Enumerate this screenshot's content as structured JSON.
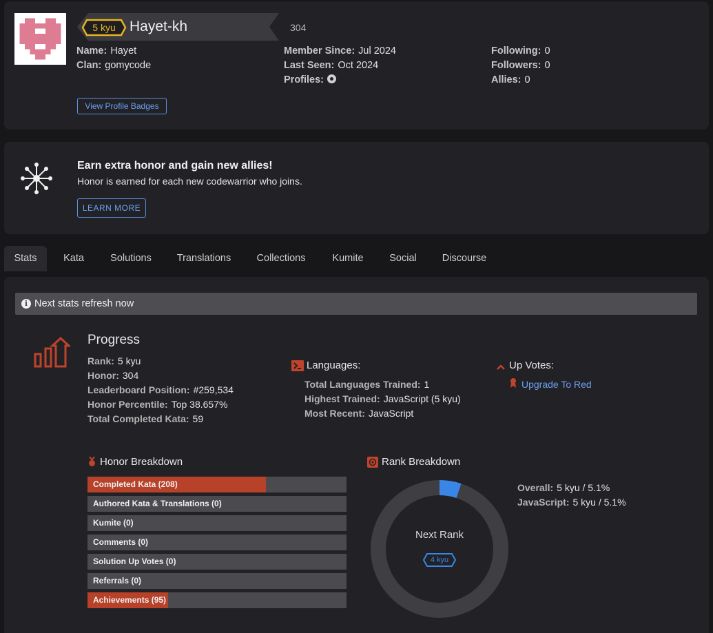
{
  "profile": {
    "rank_badge": "5 kyu",
    "username": "Hayet-kh",
    "honor": "304",
    "name_label": "Name:",
    "name_value": "Hayet",
    "clan_label": "Clan:",
    "clan_value": "gomycode",
    "member_label": "Member Since:",
    "member_value": "Jul 2024",
    "seen_label": "Last Seen:",
    "seen_value": "Oct 2024",
    "profiles_label": "Profiles:",
    "following_label": "Following:",
    "following_value": "0",
    "followers_label": "Followers:",
    "followers_value": "0",
    "allies_label": "Allies:",
    "allies_value": "0",
    "badges_button": "View Profile Badges"
  },
  "promo": {
    "title": "Earn extra honor and gain new allies!",
    "subtitle": "Honor is earned for each new codewarrior who joins.",
    "button": "LEARN MORE"
  },
  "tabs": [
    "Stats",
    "Kata",
    "Solutions",
    "Translations",
    "Collections",
    "Kumite",
    "Social",
    "Discourse"
  ],
  "stats": {
    "notice": "Next stats refresh now",
    "progress_title": "Progress",
    "rank_label": "Rank:",
    "rank_value": "5 kyu",
    "honor_label": "Honor:",
    "honor_value": "304",
    "leader_label": "Leaderboard Position:",
    "leader_value": "#259,534",
    "percentile_label": "Honor Percentile:",
    "percentile_value": "Top 38.657%",
    "completed_label": "Total Completed Kata:",
    "completed_value": "59",
    "languages_title": "Languages:",
    "lang_trained_label": "Total Languages Trained:",
    "lang_trained_value": "1",
    "highest_label": "Highest Trained:",
    "highest_value": "JavaScript (5 kyu)",
    "recent_label": "Most Recent:",
    "recent_value": "JavaScript",
    "upvotes_title": "Up Votes:",
    "upgrade_link": "Upgrade To Red",
    "honor_breakdown_title": "Honor Breakdown",
    "honor_breakdown": [
      {
        "label": "Completed Kata (208)",
        "fraction": 0.69
      },
      {
        "label": "Authored Kata & Translations (0)",
        "fraction": 0
      },
      {
        "label": "Kumite (0)",
        "fraction": 0
      },
      {
        "label": "Comments (0)",
        "fraction": 0
      },
      {
        "label": "Solution Up Votes (0)",
        "fraction": 0
      },
      {
        "label": "Referrals (0)",
        "fraction": 0
      },
      {
        "label": "Achievements (95)",
        "fraction": 0.31
      }
    ],
    "rank_breakdown_title": "Rank Breakdown",
    "next_rank_label": "Next Rank",
    "next_rank_badge": "4 kyu",
    "rank_progress_fraction": 0.051,
    "overall_label": "Overall:",
    "overall_value": "5 kyu / 5.1%",
    "js_label": "JavaScript:",
    "js_value": "5 kyu / 5.1%"
  },
  "colors": {
    "accent_red": "#b8412a",
    "link_blue": "#6aa0f0",
    "rank_yellow": "#e6b422",
    "rank_blue": "#3a86e6"
  }
}
